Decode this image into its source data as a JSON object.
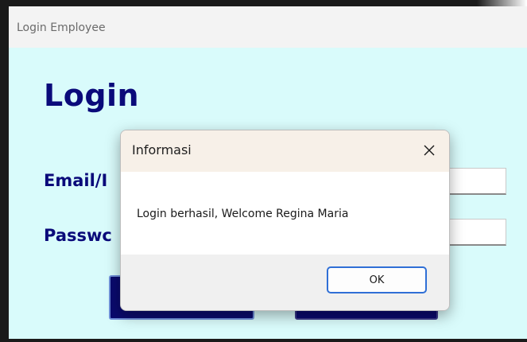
{
  "window": {
    "title": "Login Employee",
    "heading": "Login",
    "email_label": "Email/I",
    "password_label": "Passwc",
    "email_value": "",
    "password_value": ""
  },
  "dialog": {
    "title": "Informasi",
    "message": "Login berhasil, Welcome Regina Maria",
    "ok_label": "OK",
    "close_icon": "close-icon"
  },
  "colors": {
    "window_bg": "#d9fbfb",
    "heading": "#0a0a7a",
    "button_bg": "#0a0a6e",
    "ok_border": "#2f6fd6"
  }
}
